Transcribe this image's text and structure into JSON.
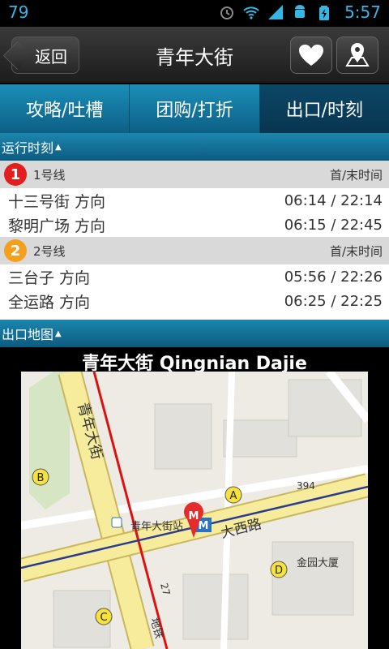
{
  "status_bar": {
    "left_number": "79",
    "time": "5:57"
  },
  "header": {
    "back_label": "返回",
    "title": "青年大街"
  },
  "tabs": [
    {
      "label": "攻略/吐槽",
      "active": false
    },
    {
      "label": "团购/打折",
      "active": false
    },
    {
      "label": "出口/时刻",
      "active": true
    }
  ],
  "schedule": {
    "section_title": "运行时刻",
    "lines": [
      {
        "badge": "1",
        "badge_color": "#e41d1d",
        "name": "1号线",
        "time_header": "首/末时间",
        "rows": [
          {
            "direction": "十三号街  方向",
            "time": "06:14 / 22:14"
          },
          {
            "direction": "黎明广场  方向",
            "time": "06:15 / 22:45"
          }
        ]
      },
      {
        "badge": "2",
        "badge_color": "#f4a01f",
        "name": "2号线",
        "time_header": "首/末时间",
        "rows": [
          {
            "direction": "三台子  方向",
            "time": "05:56 / 22:26"
          },
          {
            "direction": "全运路  方向",
            "time": "06:25 / 22:25"
          }
        ]
      }
    ]
  },
  "exit_map": {
    "section_title": "出口地图",
    "map_title": "青年大街 Qingnian Dajie",
    "labels": {
      "street_qingnian": "青年大街",
      "street_daxi": "大西路",
      "station": "青年大街站",
      "building": "金园大厦",
      "road_number": "394",
      "road_27": "27",
      "subway": "地铁",
      "exit_a": "A",
      "exit_b": "B",
      "exit_c": "C",
      "exit_d": "D",
      "marker": "M"
    }
  }
}
